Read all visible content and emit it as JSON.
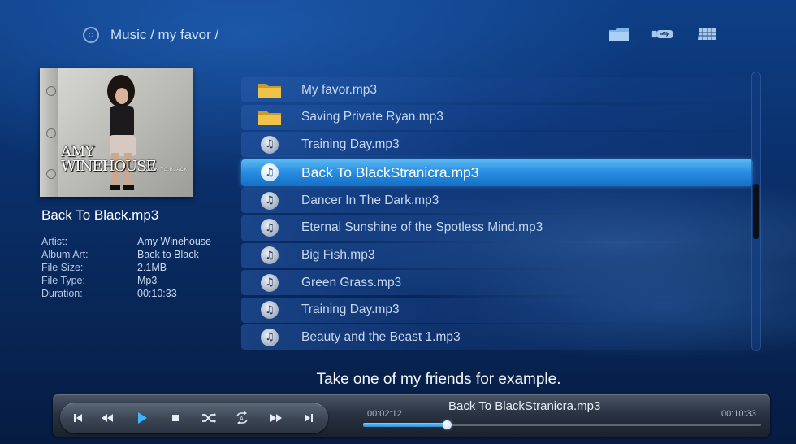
{
  "header": {
    "breadcrumb": "Music / my favor /",
    "icons": [
      "disc-icon",
      "folder-icon",
      "usb-icon",
      "grid-view-icon"
    ]
  },
  "album_art": {
    "artist_text_line1": "AMY",
    "artist_text_line2": "WINEHOUSE",
    "album_text": "BACK TO BLACK"
  },
  "info": {
    "title": "Back To Black.mp3",
    "fields": [
      {
        "label": "Artist:",
        "value": "Amy Winehouse"
      },
      {
        "label": "Album Art:",
        "value": "Back to Black"
      },
      {
        "label": "File Size:",
        "value": "2.1MB"
      },
      {
        "label": "File Type:",
        "value": "Mp3"
      },
      {
        "label": "Duration:",
        "value": "00:10:33"
      }
    ]
  },
  "file_list": {
    "selected_index": 3,
    "items": [
      {
        "name": "My favor.mp3",
        "icon": "folder-icon"
      },
      {
        "name": "Saving Private Ryan.mp3",
        "icon": "folder-icon"
      },
      {
        "name": "Training Day.mp3",
        "icon": "music-note-icon"
      },
      {
        "name": "Back To BlackStranicra.mp3",
        "icon": "music-note-icon"
      },
      {
        "name": "Dancer In The Dark.mp3",
        "icon": "music-note-icon"
      },
      {
        "name": "Eternal Sunshine of the Spotless Mind.mp3",
        "icon": "music-note-icon"
      },
      {
        "name": "Big Fish.mp3",
        "icon": "music-note-icon"
      },
      {
        "name": "Green Grass.mp3",
        "icon": "music-note-icon"
      },
      {
        "name": "Training Day.mp3",
        "icon": "music-note-icon"
      },
      {
        "name": "Beauty and the Beast 1.mp3",
        "icon": "music-note-icon"
      }
    ]
  },
  "subtitle": "Take one of my friends for example.",
  "player": {
    "now_playing": "Back To BlackStranicra.mp3",
    "elapsed": "00:02:12",
    "total": "00:10:33",
    "progress_fraction": 0.21,
    "controls": [
      "skip-previous-icon",
      "rewind-icon",
      "play-icon",
      "stop-icon",
      "shuffle-icon",
      "repeat-all-icon",
      "fast-forward-icon",
      "skip-next-icon"
    ]
  },
  "colors": {
    "accent": "#2b8fe0",
    "selected_row": "#3aa0ec",
    "background": "#0a2f6a"
  }
}
